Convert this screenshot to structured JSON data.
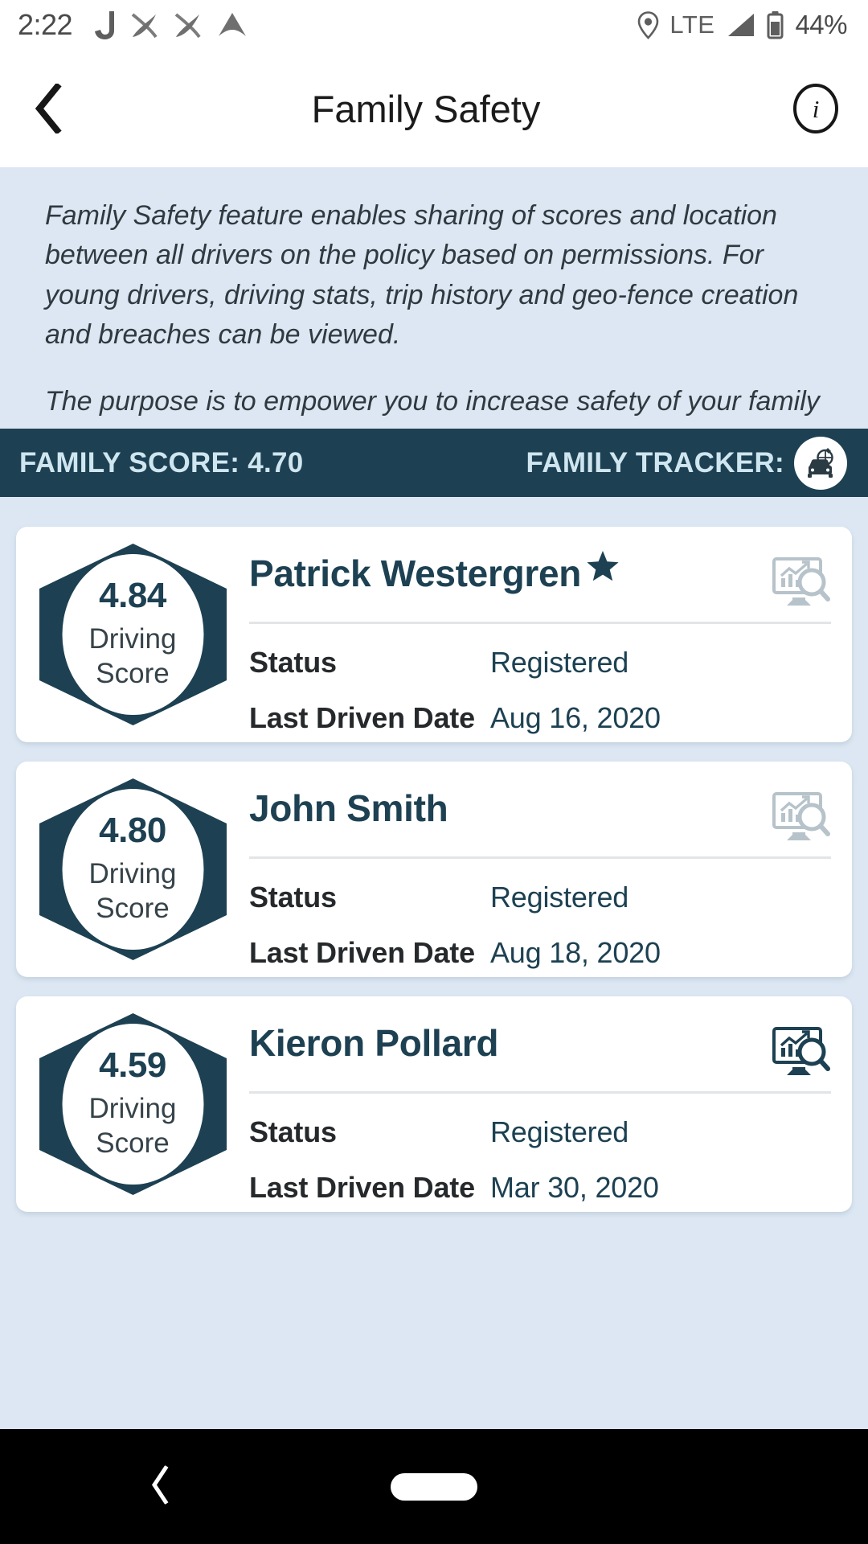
{
  "status_bar": {
    "time": "2:22",
    "left_icons": [
      "j-app-icon",
      "swoosh-app-icon",
      "swoosh-app-icon",
      "triangle-app-icon"
    ],
    "location_icon": "location-pin-icon",
    "network": "LTE",
    "signal_icon": "signal-bars-icon",
    "battery_icon": "battery-icon",
    "battery_percent": "44%"
  },
  "header": {
    "back_icon": "back-chevron-icon",
    "title": "Family Safety",
    "info_icon": "info-circle-icon"
  },
  "description": {
    "paragraph_1": "Family Safety feature enables sharing of scores and location between all drivers on the policy based on permissions. For young drivers, driving stats, trip history and geo-fence creation and breaches can be viewed.",
    "paragraph_2": "The purpose is to empower you to increase safety of your family and coach young drivers to develop good driving habits early."
  },
  "score_bar": {
    "family_score_label": "FAMILY SCORE: 4.70",
    "family_score_value": "4.70",
    "family_tracker_label": "FAMILY TRACKER:",
    "tracker_icon": "car-tracker-icon",
    "background_color": "#1d4152",
    "text_color": "#cfe6f0"
  },
  "drivers": [
    {
      "score": "4.84",
      "score_label_line1": "Driving",
      "score_label_line2": "Score",
      "name": "Patrick Westergren",
      "is_primary": true,
      "star_icon": "star-icon",
      "chart_icon": "chart-search-icon",
      "chart_icon_color": "#b7c3ca",
      "status_label": "Status",
      "status_value": "Registered",
      "last_driven_label": "Last Driven Date",
      "last_driven_value": "Aug 16, 2020"
    },
    {
      "score": "4.80",
      "score_label_line1": "Driving",
      "score_label_line2": "Score",
      "name": "John Smith",
      "is_primary": false,
      "star_icon": "star-icon",
      "chart_icon": "chart-search-icon",
      "chart_icon_color": "#b7c3ca",
      "status_label": "Status",
      "status_value": "Registered",
      "last_driven_label": "Last Driven Date",
      "last_driven_value": "Aug 18, 2020"
    },
    {
      "score": "4.59",
      "score_label_line1": "Driving",
      "score_label_line2": "Score",
      "name": "Kieron Pollard",
      "is_primary": false,
      "star_icon": "star-icon",
      "chart_icon": "chart-search-icon",
      "chart_icon_color": "#1d4152",
      "status_label": "Status",
      "status_value": "Registered",
      "last_driven_label": "Last Driven Date",
      "last_driven_value": "Mar 30, 2020"
    }
  ],
  "system_nav": {
    "back_icon": "system-back-icon",
    "home_indicator": "home-pill-indicator"
  },
  "theme": {
    "page_background": "#dce7f3",
    "accent_dark": "#1d4152",
    "card_background": "#ffffff"
  }
}
